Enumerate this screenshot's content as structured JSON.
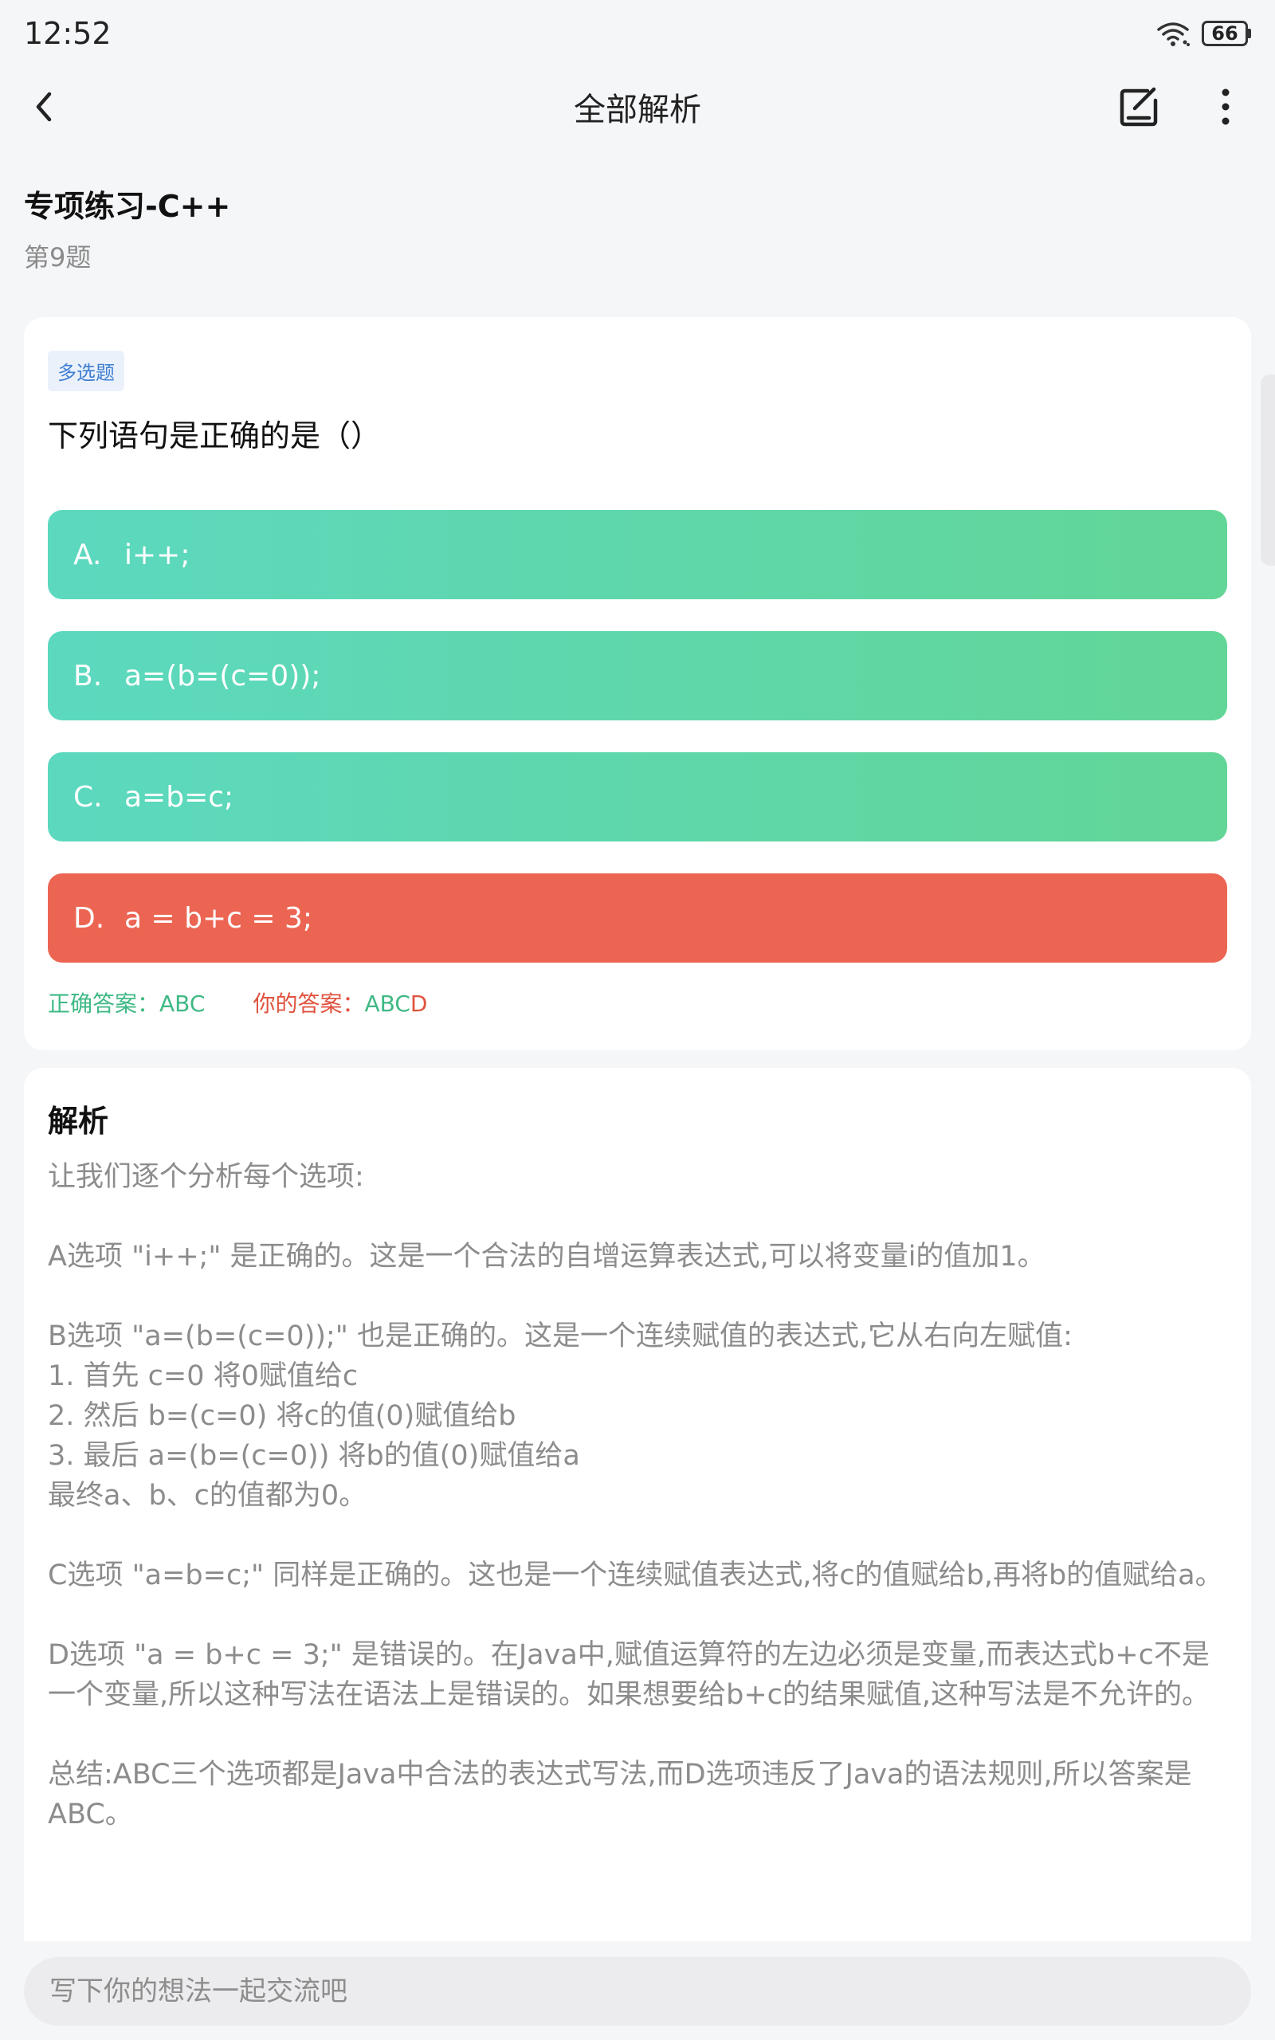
{
  "status_bar": {
    "time": "12:52",
    "battery": "66"
  },
  "nav": {
    "title": "全部解析",
    "back_icon": "chevron-left-icon",
    "edit_icon": "edit-note-icon",
    "more_icon": "more-vertical-icon"
  },
  "header": {
    "section_title": "专项练习-C++",
    "question_number": "第9题"
  },
  "question": {
    "type_badge": "多选题",
    "text": "下列语句是正确的是（）",
    "options": [
      {
        "letter": "A.",
        "text": "i++;",
        "state": "correct"
      },
      {
        "letter": "B.",
        "text": "a=(b=(c=0));",
        "state": "correct"
      },
      {
        "letter": "C.",
        "text": "a=b=c;",
        "state": "correct"
      },
      {
        "letter": "D.",
        "text": "a = b+c = 3;",
        "state": "wrong"
      }
    ],
    "correct_answer": "正确答案：ABC",
    "user_answer_label": "你的答案：",
    "user_answer_correct_part": "ABC",
    "user_answer_wrong_part": "D"
  },
  "analysis": {
    "title": "解析",
    "lines": [
      "让我们逐个分析每个选项:",
      "",
      "A选项 \"i++;\" 是正确的。这是一个合法的自增运算表达式,可以将变量i的值加1。",
      "",
      "B选项 \"a=(b=(c=0));\" 也是正确的。这是一个连续赋值的表达式,它从右向左赋值:",
      "1. 首先 c=0 将0赋值给c",
      "2. 然后 b=(c=0) 将c的值(0)赋值给b",
      "3. 最后 a=(b=(c=0)) 将b的值(0)赋值给a",
      "最终a、b、c的值都为0。",
      "",
      "C选项 \"a=b=c;\" 同样是正确的。这也是一个连续赋值表达式,将c的值赋给b,再将b的值赋给a。",
      "",
      "D选项 \"a = b+c = 3;\" 是错误的。在Java中,赋值运算符的左边必须是变量,而表达式b+c不是一个变量,所以这种写法在语法上是错误的。如果想要给b+c的结果赋值,这种写法是不允许的。",
      "",
      "总结:ABC三个选项都是Java中合法的表达式写法,而D选项违反了Java的语法规则,所以答案是ABC。"
    ]
  },
  "comment": {
    "placeholder": "写下你的想法一起交流吧"
  },
  "colors": {
    "correct_gradient_start": "#5cd8bf",
    "correct_gradient_end": "#62d697",
    "wrong": "#ec6552",
    "correct_text": "#3fb985",
    "wrong_text": "#e0533f",
    "badge_text": "#3e7ed3"
  }
}
